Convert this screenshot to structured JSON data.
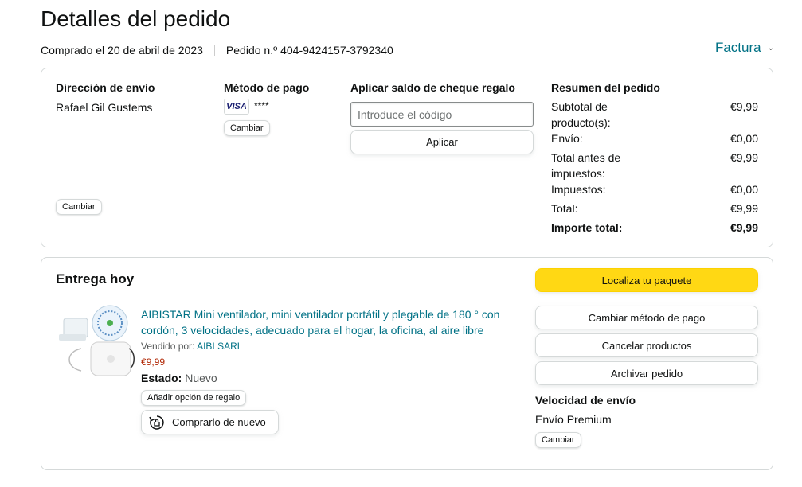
{
  "page": {
    "title": "Detalles del pedido",
    "purchased": "Comprado el 20 de abril de 2023",
    "order_number": "Pedido n.º 404-9424157-3792340",
    "invoice": "Factura"
  },
  "shipping": {
    "heading": "Dirección de envío",
    "name": "Rafael Gil Gustems",
    "change": "Cambiar"
  },
  "payment": {
    "heading": "Método de pago",
    "card_brand": "VISA",
    "card_mask": "****",
    "change": "Cambiar"
  },
  "gift": {
    "heading": "Aplicar saldo de cheque regalo",
    "placeholder": "Introduce el código",
    "apply": "Aplicar"
  },
  "summary": {
    "heading": "Resumen del pedido",
    "rows": [
      {
        "label": "Subtotal de producto(s):",
        "value": "€9,99"
      },
      {
        "label": "Envío:",
        "value": "€0,00"
      },
      {
        "label": "Total antes de impuestos:",
        "value": "€9,99"
      },
      {
        "label": "Impuestos:",
        "value": "€0,00"
      },
      {
        "label": "Total:",
        "value": "€9,99"
      },
      {
        "label": "Importe total:",
        "value": "€9,99"
      }
    ]
  },
  "delivery": {
    "heading": "Entrega hoy",
    "product": {
      "title": "AIBISTAR Mini ventilador, mini ventilador portátil y plegable de 180 ° con cordón, 3 velocidades, adecuado para el hogar, la oficina, al aire libre",
      "sold_by_label": "Vendido por:",
      "seller": "AIBI SARL",
      "price": "€9,99",
      "status_label": "Estado:",
      "status": "Nuevo",
      "gift_option": "Añadir opción de regalo",
      "buy_again": "Comprarlo de nuevo"
    },
    "actions": {
      "track": "Localiza tu paquete",
      "change_payment": "Cambiar método de pago",
      "cancel": "Cancelar productos",
      "archive": "Archivar pedido"
    },
    "speed": {
      "heading": "Velocidad de envío",
      "value": "Envío Premium",
      "change": "Cambiar"
    }
  },
  "colors": {
    "link": "#007185",
    "price": "#b12704",
    "primary_button": "#ffd814"
  }
}
